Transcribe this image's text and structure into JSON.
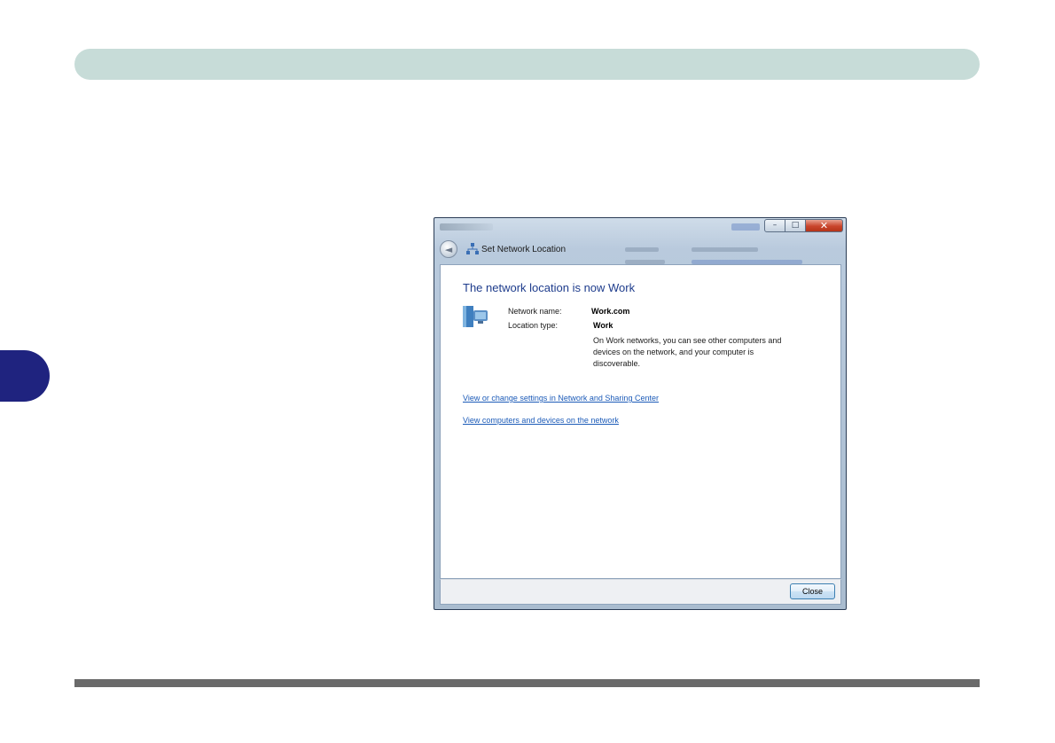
{
  "window": {
    "title": "Set Network Location",
    "controls": {
      "minimize": "–",
      "maximize": "□",
      "close": "✕"
    },
    "back_glyph": "◄"
  },
  "content": {
    "heading": "The network location is now Work",
    "network_name_label": "Network name:",
    "network_name_value": "Work.com",
    "location_type_label": "Location type:",
    "location_type_value": "Work",
    "description": "On Work networks, you can see other computers and devices on the network, and your computer is discoverable.",
    "links": [
      {
        "label": "View or change settings in Network and Sharing Center"
      },
      {
        "label": "View computers and devices on the network"
      }
    ]
  },
  "footer": {
    "close_label": "Close"
  },
  "colors": {
    "banner": "#c7dcd8",
    "side_tab": "#1f237f",
    "heading": "#1e3c8c",
    "link": "#1c5bb8"
  },
  "icons": {
    "window_icon": "network-icon",
    "location_icon": "work-network-icon"
  }
}
